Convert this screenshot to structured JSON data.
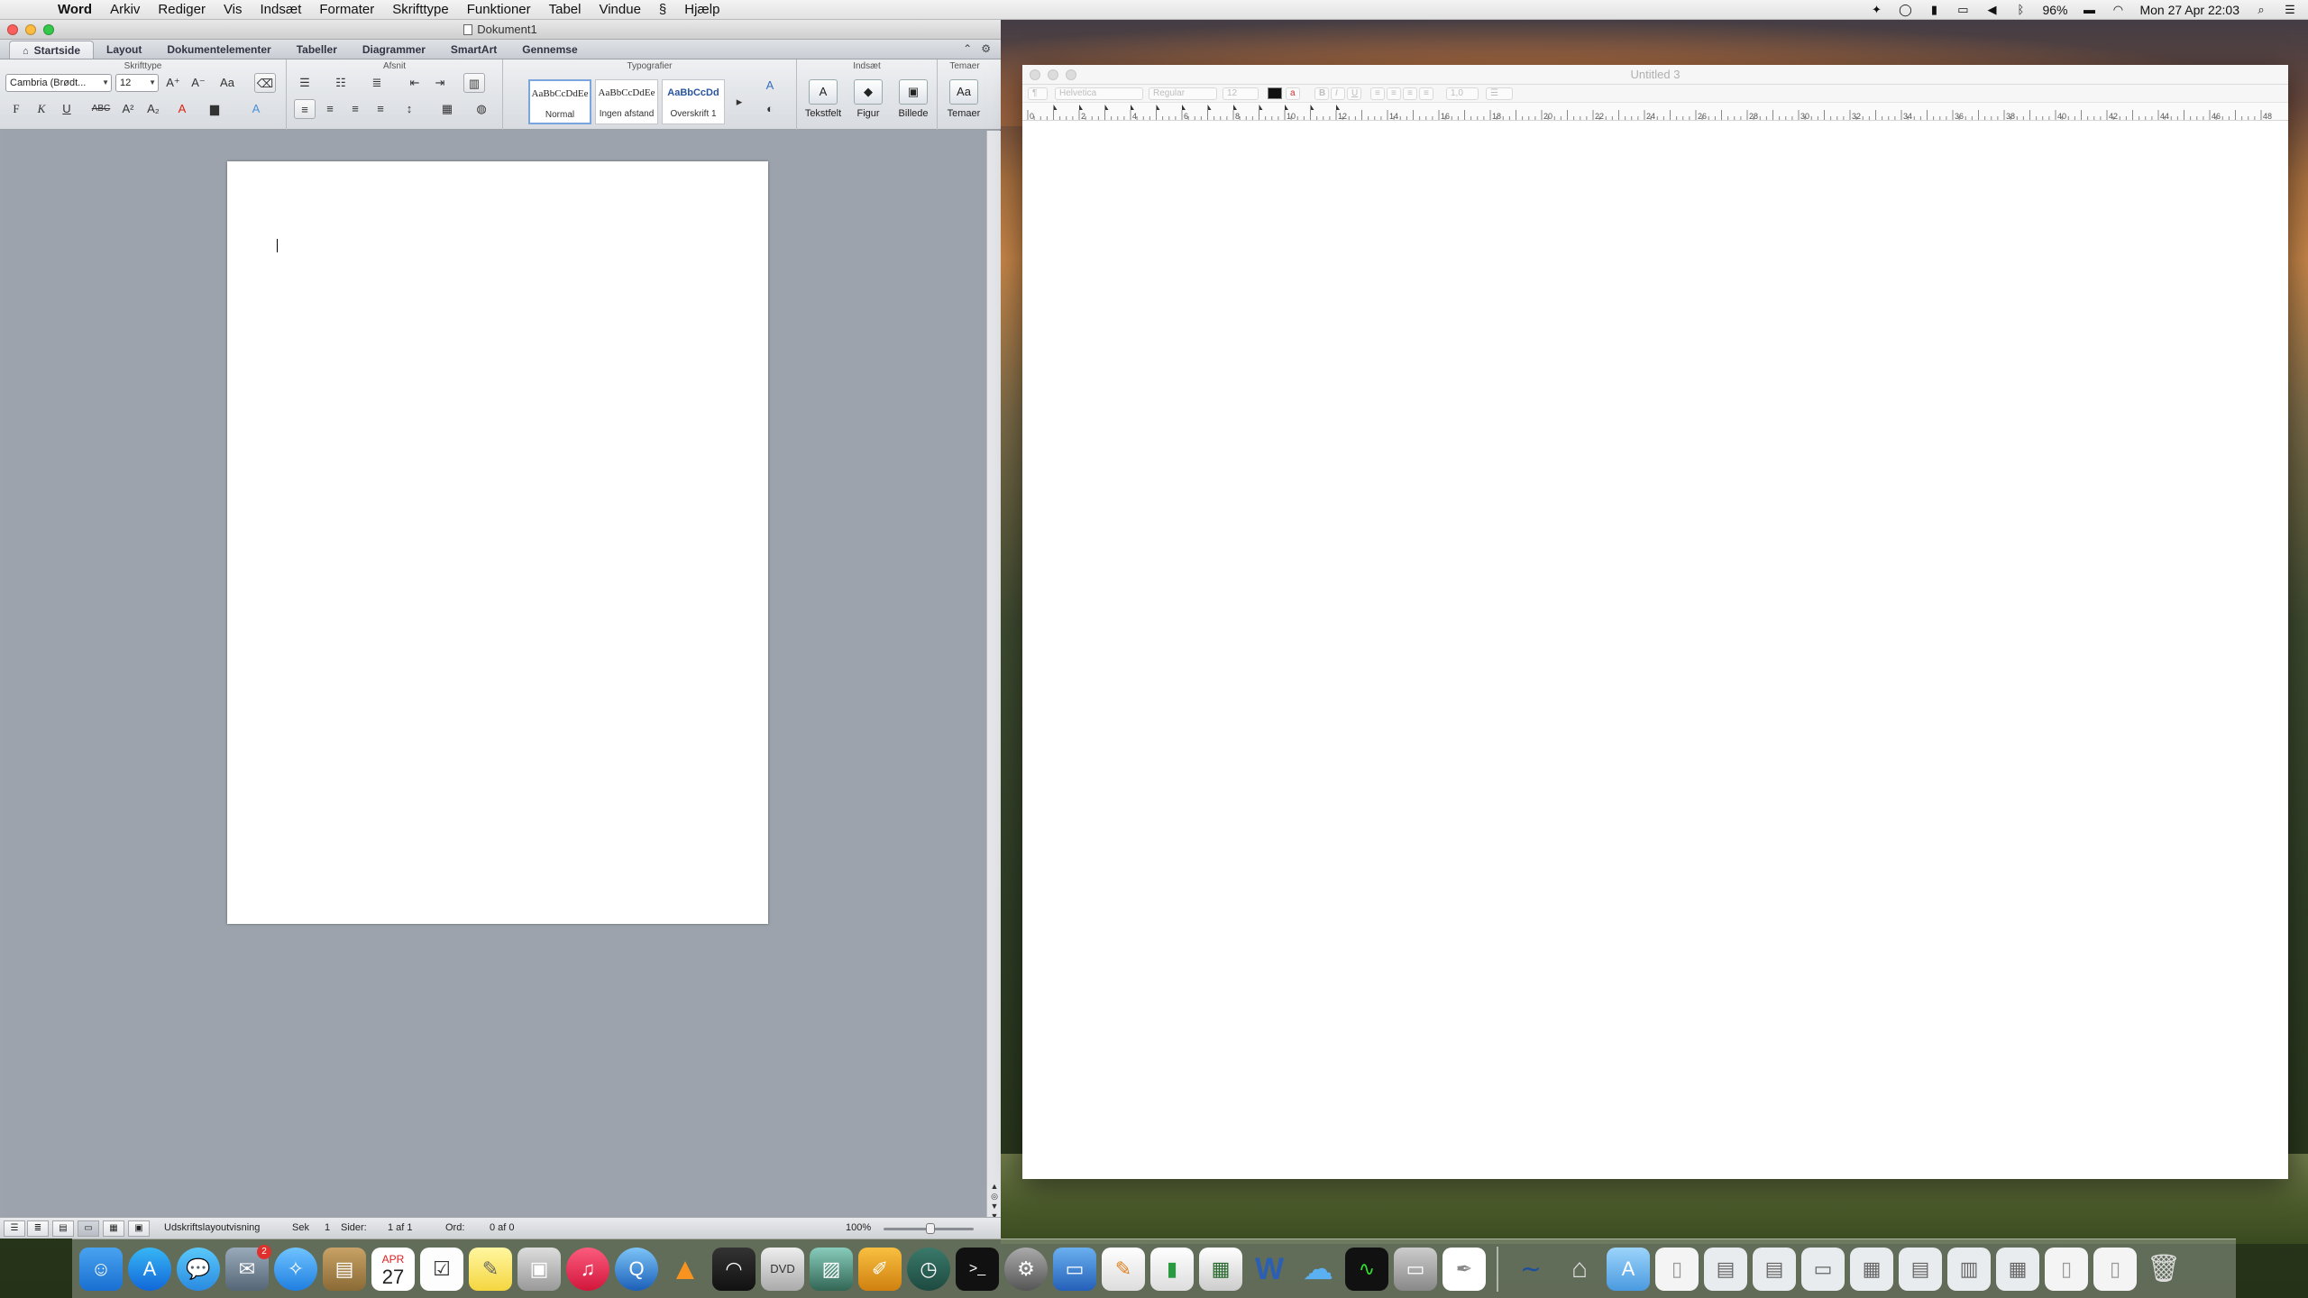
{
  "menubar": {
    "app": "Word",
    "items": [
      "Arkiv",
      "Rediger",
      "Vis",
      "Indsæt",
      "Formater",
      "Skrifttype",
      "Funktioner",
      "Tabel",
      "Vindue",
      "Hjælp"
    ],
    "battery": "96%",
    "clock": "Mon 27 Apr  22:03"
  },
  "word": {
    "title": "Dokument1",
    "tabs": [
      "Startside",
      "Layout",
      "Dokumentelementer",
      "Tabeller",
      "Diagrammer",
      "SmartArt",
      "Gennemse"
    ],
    "groups": {
      "font": "Skrifttype",
      "paragraph": "Afsnit",
      "styles": "Typografier",
      "insert": "Indsæt",
      "themes": "Temaer"
    },
    "font_name": "Cambria (Brødt...",
    "font_size": "12",
    "styles": [
      {
        "sample": "AaBbCcDdEe",
        "name": "Normal"
      },
      {
        "sample": "AaBbCcDdEe",
        "name": "Ingen afstand"
      },
      {
        "sample": "AaBbCcDd",
        "name": "Overskrift 1"
      }
    ],
    "insert_buttons": [
      "Tekstfelt",
      "Figur",
      "Billede"
    ],
    "themes_button": "Temaer",
    "status": {
      "view": "Udskriftslayoutvisning",
      "section_label": "Sek",
      "section_value": "1",
      "pages_label": "Sider:",
      "pages_value": "1 af 1",
      "words_label": "Ord:",
      "words_value": "0 af 0",
      "zoom": "100%"
    }
  },
  "textedit": {
    "title": "Untitled 3",
    "font": "Helvetica",
    "style": "Regular",
    "size": "12",
    "spacing": "1,0",
    "ruler_labels": [
      "0",
      "2",
      "4",
      "6",
      "8",
      "10",
      "12",
      "14",
      "16",
      "18",
      "20",
      "22",
      "24",
      "26",
      "28",
      "30",
      "32",
      "34",
      "36",
      "38",
      "40",
      "42",
      "44",
      "46",
      "48"
    ]
  },
  "dock": {
    "calendar_month": "APR",
    "calendar_day": "27",
    "mail_badge": "2"
  }
}
